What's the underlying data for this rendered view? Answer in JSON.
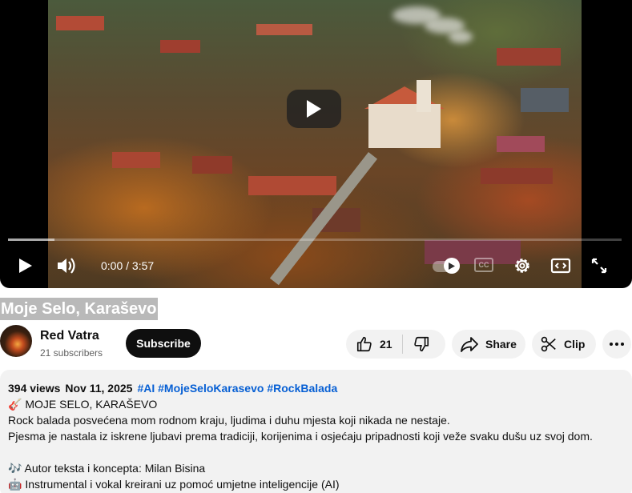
{
  "player": {
    "time_current": "0:00",
    "time_total": "3:57",
    "time_separator": " / ",
    "cc_label": "CC"
  },
  "video": {
    "title": "Moje Selo, Karaševo"
  },
  "channel": {
    "name": "Red Vatra",
    "subscribers": "21 subscribers",
    "subscribe_label": "Subscribe"
  },
  "actions": {
    "like_count": "21",
    "share_label": "Share",
    "clip_label": "Clip"
  },
  "description": {
    "views": "394 views",
    "date": "Nov 11, 2025",
    "tags": [
      "#AI",
      "#MojeSeloKarasevo",
      "#RockBalada"
    ],
    "lines": [
      "🎸 MOJE SELO, KARAŠEVO",
      "Rock balada posvećena mom rodnom kraju, ljudima i duhu mjesta koji nikada ne nestaje.",
      "Pjesma je nastala iz iskrene ljubavi prema tradiciji, korijenima i osjećaju pripadnosti koji veže svaku dušu uz svoj dom.",
      "",
      "🎶 Autor teksta i koncepta: Milan Bisina",
      "🤖 Instrumental i vokal kreirani uz pomoć umjetne inteligencije (AI)"
    ]
  }
}
